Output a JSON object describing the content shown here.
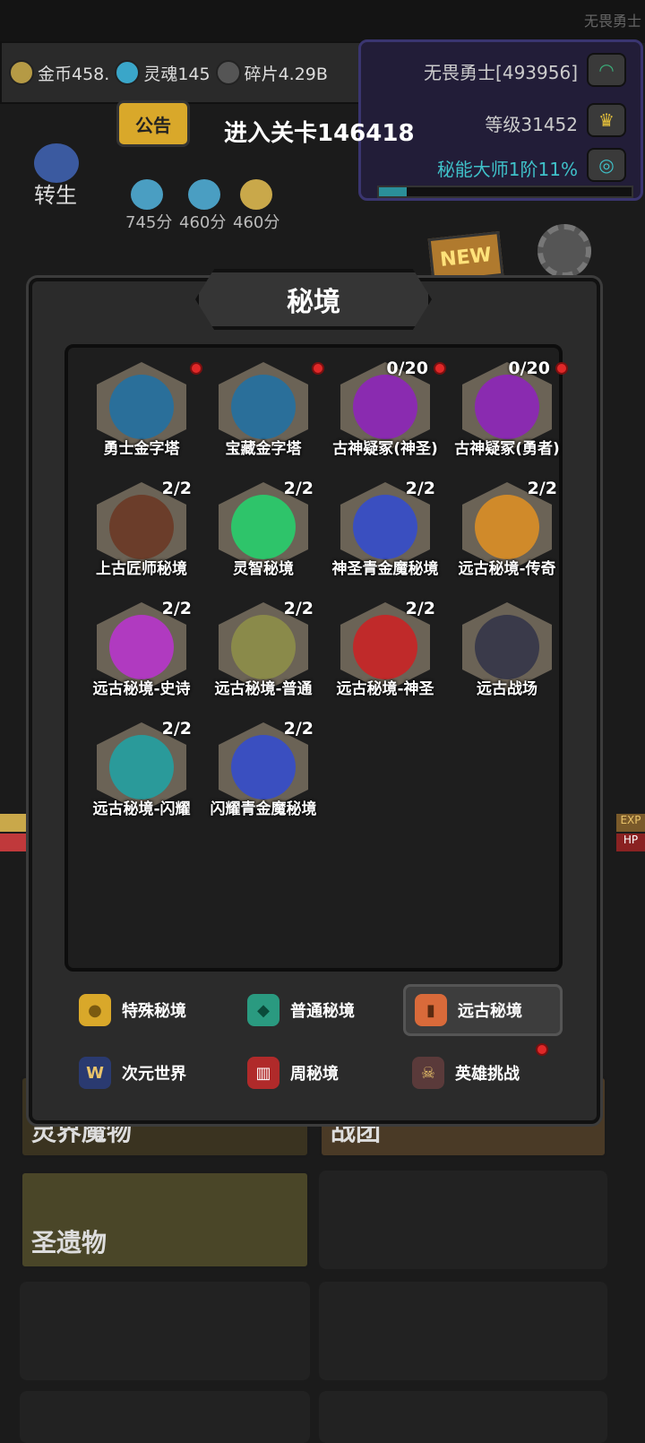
{
  "header": {
    "top_right_name": "无畏勇士"
  },
  "currency": [
    {
      "label": "金币458.",
      "icon": "gold-coin-icon"
    },
    {
      "label": "灵魂145",
      "icon": "soul-icon"
    },
    {
      "label": "碎片4.29B",
      "icon": "fragment-icon"
    }
  ],
  "player": {
    "name": "无畏勇士[493956]",
    "level": "等级31452",
    "title": "秘能大师1阶11%",
    "progress_percent": 11
  },
  "notice_label": "公告",
  "stage_text": "进入关卡146418",
  "rebirth_label": "转生",
  "scores": [
    "745分",
    "460分",
    "460分"
  ],
  "new_badge": "NEW",
  "side": {
    "exp": "EXP",
    "hp": "HP"
  },
  "modal": {
    "title": "秘境",
    "dungeons": [
      {
        "name": "勇士金字塔",
        "count": "",
        "dot": true,
        "color": "#2a6f9a"
      },
      {
        "name": "宝藏金字塔",
        "count": "",
        "dot": true,
        "color": "#2a6f9a"
      },
      {
        "name": "古神疑冢(神圣)",
        "count": "0/20",
        "dot": true,
        "color": "#8a2bb0"
      },
      {
        "name": "古神疑冢(勇者)",
        "count": "0/20",
        "dot": true,
        "color": "#8a2bb0"
      },
      {
        "name": "上古匠师秘境",
        "count": "2/2",
        "dot": false,
        "color": "#6b3d2a"
      },
      {
        "name": "灵智秘境",
        "count": "2/2",
        "dot": false,
        "color": "#2ec46a"
      },
      {
        "name": "神圣青金魔秘境",
        "count": "2/2",
        "dot": false,
        "color": "#3a4fc0"
      },
      {
        "name": "远古秘境-传奇",
        "count": "2/2",
        "dot": false,
        "color": "#d08a2a"
      },
      {
        "name": "远古秘境-史诗",
        "count": "2/2",
        "dot": false,
        "color": "#b03ac0"
      },
      {
        "name": "远古秘境-普通",
        "count": "2/2",
        "dot": false,
        "color": "#8a8a4a"
      },
      {
        "name": "远古秘境-神圣",
        "count": "2/2",
        "dot": false,
        "color": "#c02a2a"
      },
      {
        "name": "远古战场",
        "count": "",
        "dot": false,
        "color": "#3a3a4a"
      },
      {
        "name": "远古秘境-闪耀",
        "count": "2/2",
        "dot": false,
        "color": "#2a9a9a"
      },
      {
        "name": "闪耀青金魔秘境",
        "count": "2/2",
        "dot": false,
        "color": "#3a4fc0"
      }
    ],
    "categories": [
      {
        "label": "特殊秘境",
        "icon": "gold-egg-icon",
        "selected": false,
        "dot": false
      },
      {
        "label": "普通秘境",
        "icon": "green-gem-icon",
        "selected": false,
        "dot": false
      },
      {
        "label": "远古秘境",
        "icon": "ancient-shield-icon",
        "selected": true,
        "dot": false
      },
      {
        "label": "次元世界",
        "icon": "w-star-icon",
        "selected": false,
        "dot": false
      },
      {
        "label": "周秘境",
        "icon": "red-gate-icon",
        "selected": false,
        "dot": false
      },
      {
        "label": "英雄挑战",
        "icon": "hero-mask-icon",
        "selected": false,
        "dot": true
      }
    ]
  },
  "bottom_cards": [
    "灵界魔物",
    "战团",
    "圣遗物"
  ]
}
